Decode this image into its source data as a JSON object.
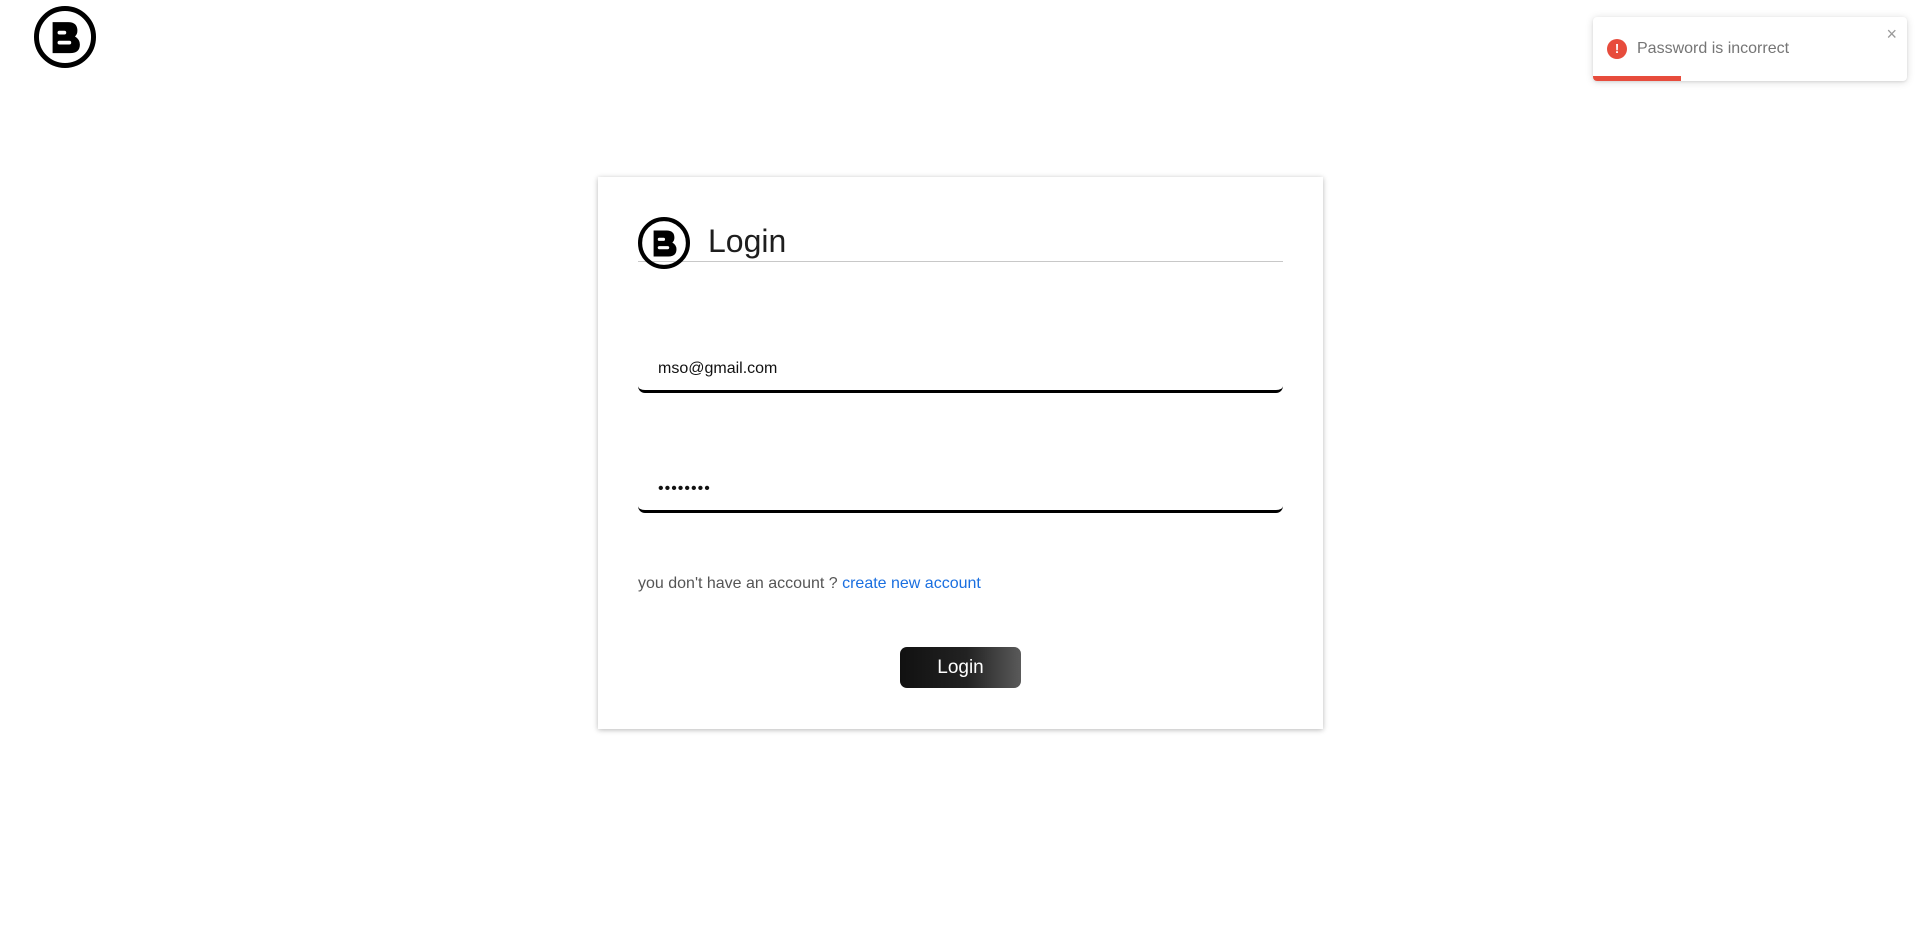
{
  "toast": {
    "message": "Password is incorrect",
    "close_glyph": "×",
    "icon_glyph": "!",
    "icon": "error-icon",
    "color": "#e74c3c",
    "progress": 0.28
  },
  "brand": {
    "icon": "blogger-logo-icon",
    "color": "#000000"
  },
  "login": {
    "title": "Login",
    "email_value": "mso@gmail.com",
    "password_value": "password",
    "signup_prompt": "you don't have an account ? ",
    "signup_link": "create new account",
    "button_label": "Login",
    "link_color": "#1a6fe0"
  }
}
